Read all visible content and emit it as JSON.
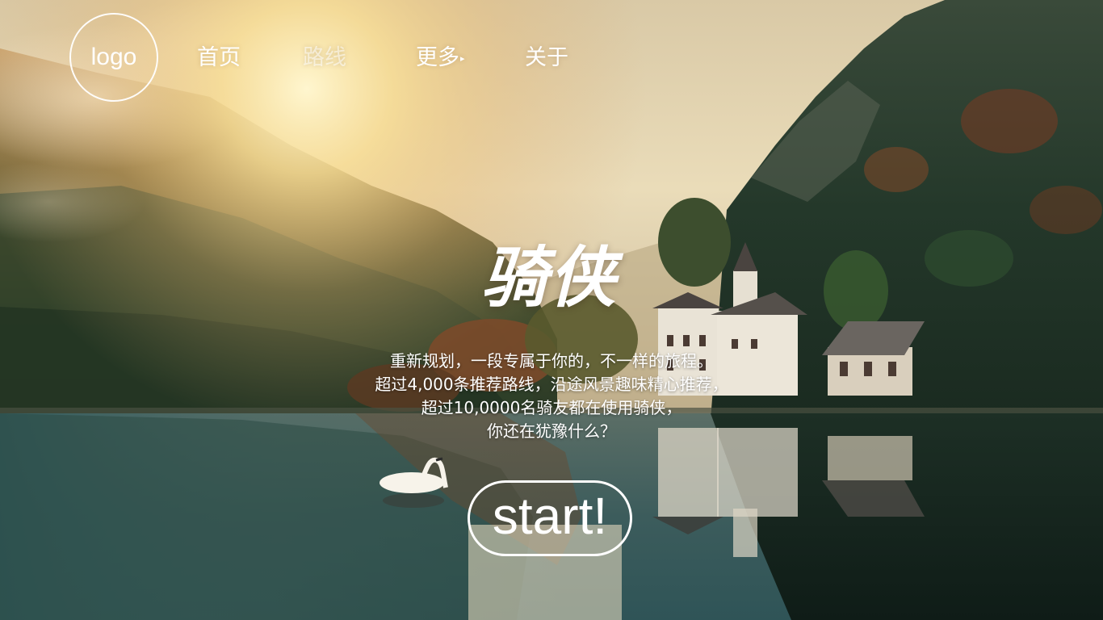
{
  "brand": {
    "logo_text": "logo"
  },
  "nav": {
    "items": [
      {
        "label": "首页"
      },
      {
        "label": "路线"
      },
      {
        "label": "更多",
        "has_arrow": true,
        "arrow_icon": "triangle-right-icon"
      },
      {
        "label": "关于"
      }
    ]
  },
  "hero": {
    "title": "骑侠",
    "lines": [
      "重新规划，一段专属于你的，不一样的旅程。",
      "超过4,000条推荐路线，沿途风景趣味精心推荐，",
      "超过10,0000名骑友都在使用骑侠，",
      "你还在犹豫什么？"
    ],
    "cta_label": "start!"
  },
  "colors": {
    "text": "#ffffff",
    "sky": "#e8d7b4",
    "sun": "#fff3c6",
    "forest_dark": "#1f3325",
    "lake": "#3a5a5a"
  }
}
